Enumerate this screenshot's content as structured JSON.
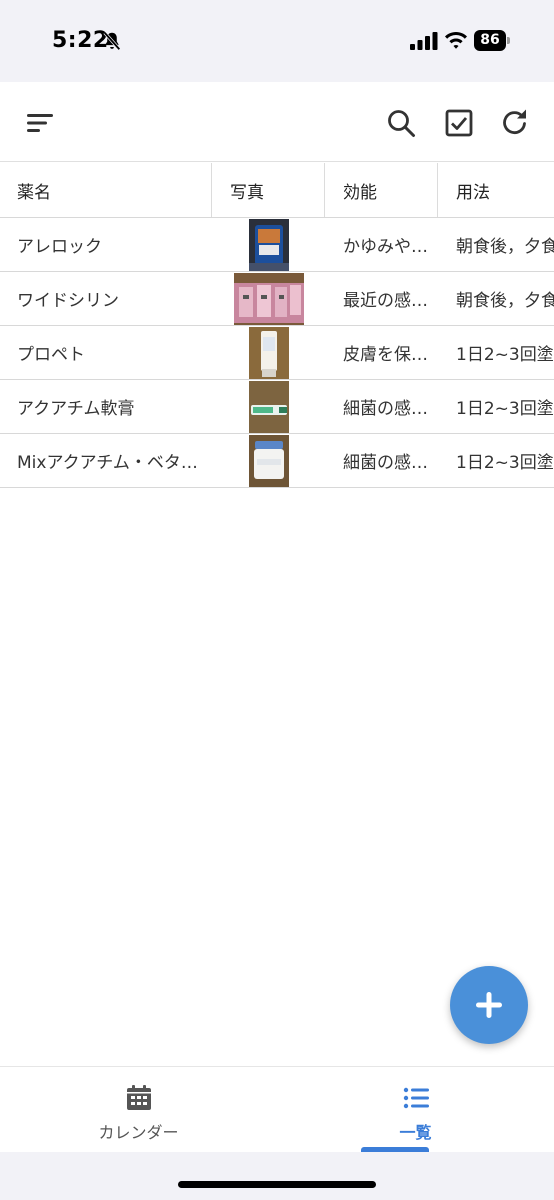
{
  "status_bar": {
    "time": "5:22",
    "battery": "86"
  },
  "toolbar": {
    "menu_icon": "sort-menu-icon",
    "search_icon": "search-icon",
    "check_icon": "checkbox-icon",
    "refresh_icon": "refresh-icon"
  },
  "table": {
    "headers": [
      "薬名",
      "写真",
      "効能",
      "用法"
    ],
    "rows": [
      {
        "name": "アレロック",
        "effect": "かゆみや…",
        "usage": "朝食後，夕食"
      },
      {
        "name": "ワイドシリン",
        "effect": "最近の感…",
        "usage": "朝食後，夕食"
      },
      {
        "name": "プロペト",
        "effect": "皮膚を保…",
        "usage": "1日2~3回塗"
      },
      {
        "name": "アクアチム軟膏",
        "effect": "細菌の感…",
        "usage": "1日2~3回塗"
      },
      {
        "name": "Mixアクアチム・ベタ…",
        "effect": "細菌の感…",
        "usage": "1日2~3回塗"
      }
    ]
  },
  "fab": {
    "icon": "plus-icon"
  },
  "bottom_nav": {
    "items": [
      {
        "label": "カレンダー",
        "icon": "calendar-icon"
      },
      {
        "label": "一覧",
        "icon": "list-icon"
      }
    ]
  },
  "colors": {
    "accent": "#4a90d9",
    "nav_active": "#3b7dd8"
  }
}
